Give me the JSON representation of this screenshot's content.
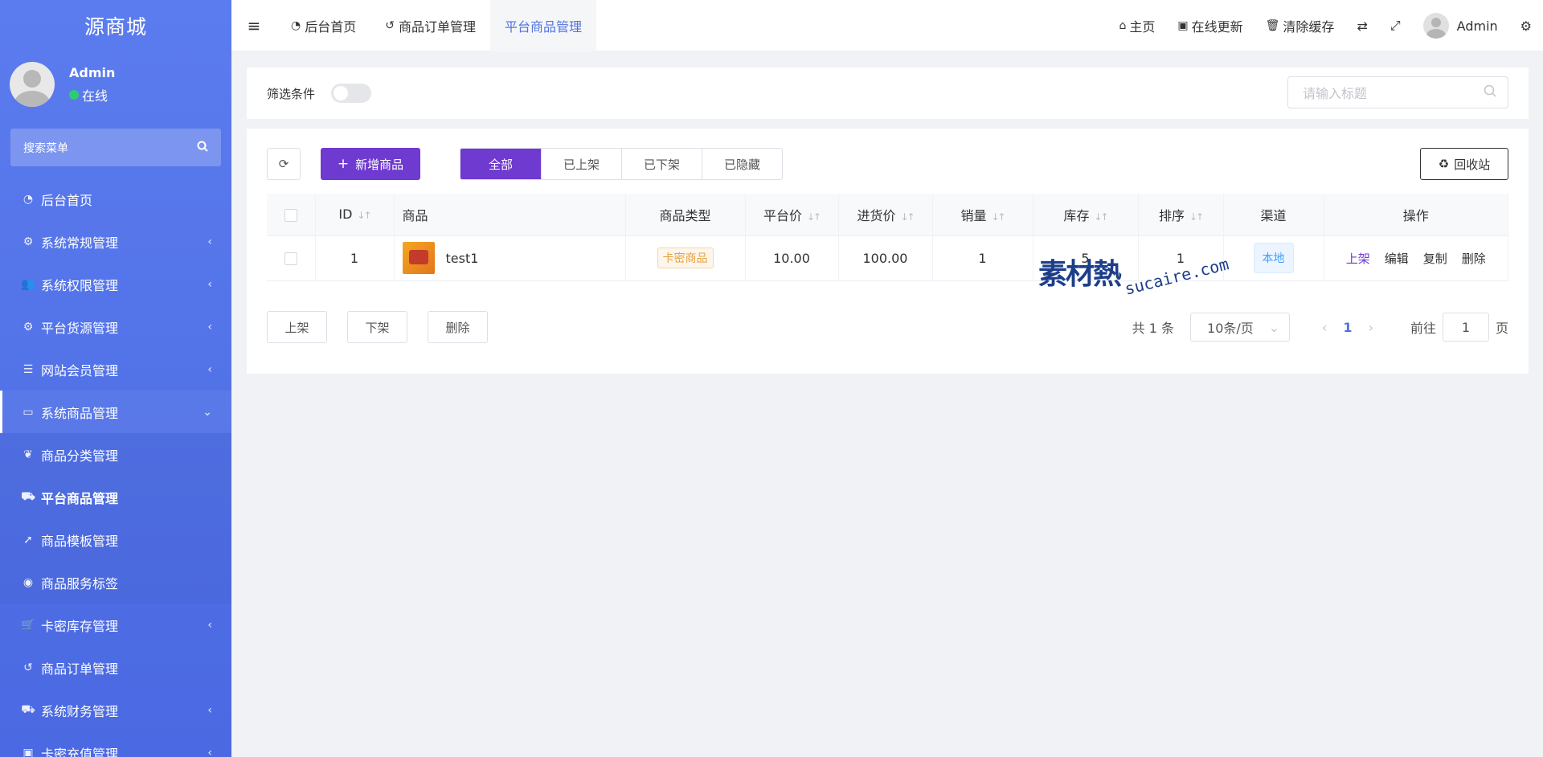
{
  "sidebar": {
    "brand": "源商城",
    "user": {
      "name": "Admin",
      "status": "在线"
    },
    "search_placeholder": "搜索菜单",
    "items": [
      {
        "label": "后台首页",
        "icon": "dashboard-icon"
      },
      {
        "label": "系统常规管理",
        "icon": "cogs-icon"
      },
      {
        "label": "系统权限管理",
        "icon": "users-icon"
      },
      {
        "label": "平台货源管理",
        "icon": "cogs-icon"
      },
      {
        "label": "网站会员管理",
        "icon": "list-icon"
      },
      {
        "label": "系统商品管理",
        "icon": "card-icon"
      },
      {
        "label": "商品分类管理",
        "icon": "leaf-icon"
      },
      {
        "label": "平台商品管理",
        "icon": "binoculars-icon"
      },
      {
        "label": "商品模板管理",
        "icon": "rocket-icon"
      },
      {
        "label": "商品服务标签",
        "icon": "compass-icon"
      },
      {
        "label": "卡密库存管理",
        "icon": "cart-icon"
      },
      {
        "label": "商品订单管理",
        "icon": "history-icon"
      },
      {
        "label": "系统财务管理",
        "icon": "binoculars-icon"
      },
      {
        "label": "卡密充值管理",
        "icon": "money-icon"
      }
    ]
  },
  "topbar": {
    "tabs": [
      {
        "label": "后台首页",
        "icon": "dashboard-icon"
      },
      {
        "label": "商品订单管理",
        "icon": "history-icon"
      },
      {
        "label": "平台商品管理"
      }
    ],
    "right": {
      "home": "主页",
      "update": "在线更新",
      "clear_cache": "清除缓存",
      "user": "Admin"
    }
  },
  "filter": {
    "label": "筛选条件",
    "search_placeholder": "请输入标题"
  },
  "toolbar": {
    "add_label": "新增商品",
    "segments": [
      "全部",
      "已上架",
      "已下架",
      "已隐藏"
    ],
    "recycle_label": "回收站"
  },
  "table": {
    "headers": {
      "id": "ID",
      "product": "商品",
      "type": "商品类型",
      "platform_price": "平台价",
      "cost_price": "进货价",
      "sales": "销量",
      "stock": "库存",
      "sort": "排序",
      "channel": "渠道",
      "actions": "操作"
    },
    "rows": [
      {
        "id": "1",
        "name": "test1",
        "type": "卡密商品",
        "platform_price": "10.00",
        "cost_price": "100.00",
        "sales": "1",
        "stock": "5",
        "sort": "1",
        "channel": "本地",
        "actions": {
          "up": "上架",
          "edit": "编辑",
          "copy": "复制",
          "delete": "删除"
        }
      }
    ]
  },
  "bulk": {
    "up": "上架",
    "down": "下架",
    "delete": "删除"
  },
  "pagination": {
    "total": "共 1 条",
    "page_size": "10条/页",
    "current": "1",
    "goto_label": "前往",
    "goto_value": "1",
    "page_unit": "页"
  },
  "watermark": {
    "logo": "素材熱",
    "text": "sucaire.com"
  }
}
